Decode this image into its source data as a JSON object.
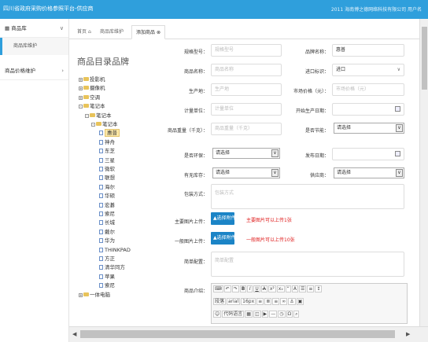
{
  "header": {
    "title": "四川省政府采购价格参照平台-供应商",
    "company": "2011 海南博之德网络科技有限公司 用户名"
  },
  "sidebar": {
    "items": [
      {
        "label": "商品库"
      },
      {
        "label": "商品库维护"
      },
      {
        "label": "商品价格维护"
      }
    ]
  },
  "tabs": [
    {
      "label": "首页"
    },
    {
      "label": "商品库维护"
    },
    {
      "label": "添加商品"
    }
  ],
  "catalog": {
    "title": "商品目录品牌",
    "nodes": [
      {
        "label": "投影机",
        "toggle": "+",
        "level": 0
      },
      {
        "label": "摄像机",
        "toggle": "+",
        "level": 0
      },
      {
        "label": "空调",
        "toggle": "+",
        "level": 0
      },
      {
        "label": "笔记本",
        "toggle": "-",
        "level": 0
      },
      {
        "label": "笔记本",
        "toggle": "-",
        "level": 1
      },
      {
        "label": "笔记本",
        "toggle": "-",
        "level": 2
      },
      {
        "label": "惠普",
        "level": 3,
        "selected": true
      },
      {
        "label": "神舟",
        "level": 3
      },
      {
        "label": "东芝",
        "level": 3
      },
      {
        "label": "三星",
        "level": 3
      },
      {
        "label": "微软",
        "level": 3
      },
      {
        "label": "联想",
        "level": 3
      },
      {
        "label": "海尔",
        "level": 3
      },
      {
        "label": "华硕",
        "level": 3
      },
      {
        "label": "宏碁",
        "level": 3
      },
      {
        "label": "索尼",
        "level": 3
      },
      {
        "label": "长城",
        "level": 3
      },
      {
        "label": "戴尔",
        "level": 3
      },
      {
        "label": "华为",
        "level": 3
      },
      {
        "label": "THINKPAD",
        "level": 3
      },
      {
        "label": "方正",
        "level": 3
      },
      {
        "label": "清华同方",
        "level": 3
      },
      {
        "label": "苹果",
        "level": 3
      },
      {
        "label": "索尼",
        "level": 3
      },
      {
        "label": "一体电脑",
        "toggle": "+",
        "level": 0
      }
    ]
  },
  "form": {
    "spec_label": "规格型号：",
    "spec_ph": "规格型号",
    "brand_label": "品牌名称：",
    "brand_value": "惠普",
    "name_label": "商品名称：",
    "name_ph": "商品名称",
    "import_label": "进口标识：",
    "import_value": "进口",
    "producer_label": "生产地：",
    "producer_ph": "生产地",
    "price_label": "市场价格（元）：",
    "price_ph": "市场价格（元）",
    "unit_label": "计量单位：",
    "unit_ph": "计量单位",
    "date_label": "开始生产日期：",
    "weight_label": "商品重量（千克）：",
    "weight_ph": "商品重量（千克）",
    "energy_label": "是否节能：",
    "energy_value": "请选择",
    "env_label": "是否环保：",
    "env_value": "请选择",
    "release_label": "发布日期：",
    "stock_label": "有无库存：",
    "stock_value": "请选择",
    "supply_label": "供应商：",
    "supply_value": "请选择",
    "pack_label": "包装方式：",
    "pack_ph": "包装方式",
    "mainimg_label": "主要图片上传：",
    "mainimg_btn": "选择附件",
    "mainimg_hint": "主要图片可以上传1张",
    "genimg_label": "一般图片上传：",
    "genimg_btn": "选择附件",
    "genimg_hint": "一般图片可以上传10张",
    "config_label": "简单配置：",
    "config_ph": "简单配置",
    "intro_label": "商品介绍："
  },
  "editor": {
    "format": "段落",
    "font": "arial",
    "size": "16px",
    "code": "代码语言"
  }
}
